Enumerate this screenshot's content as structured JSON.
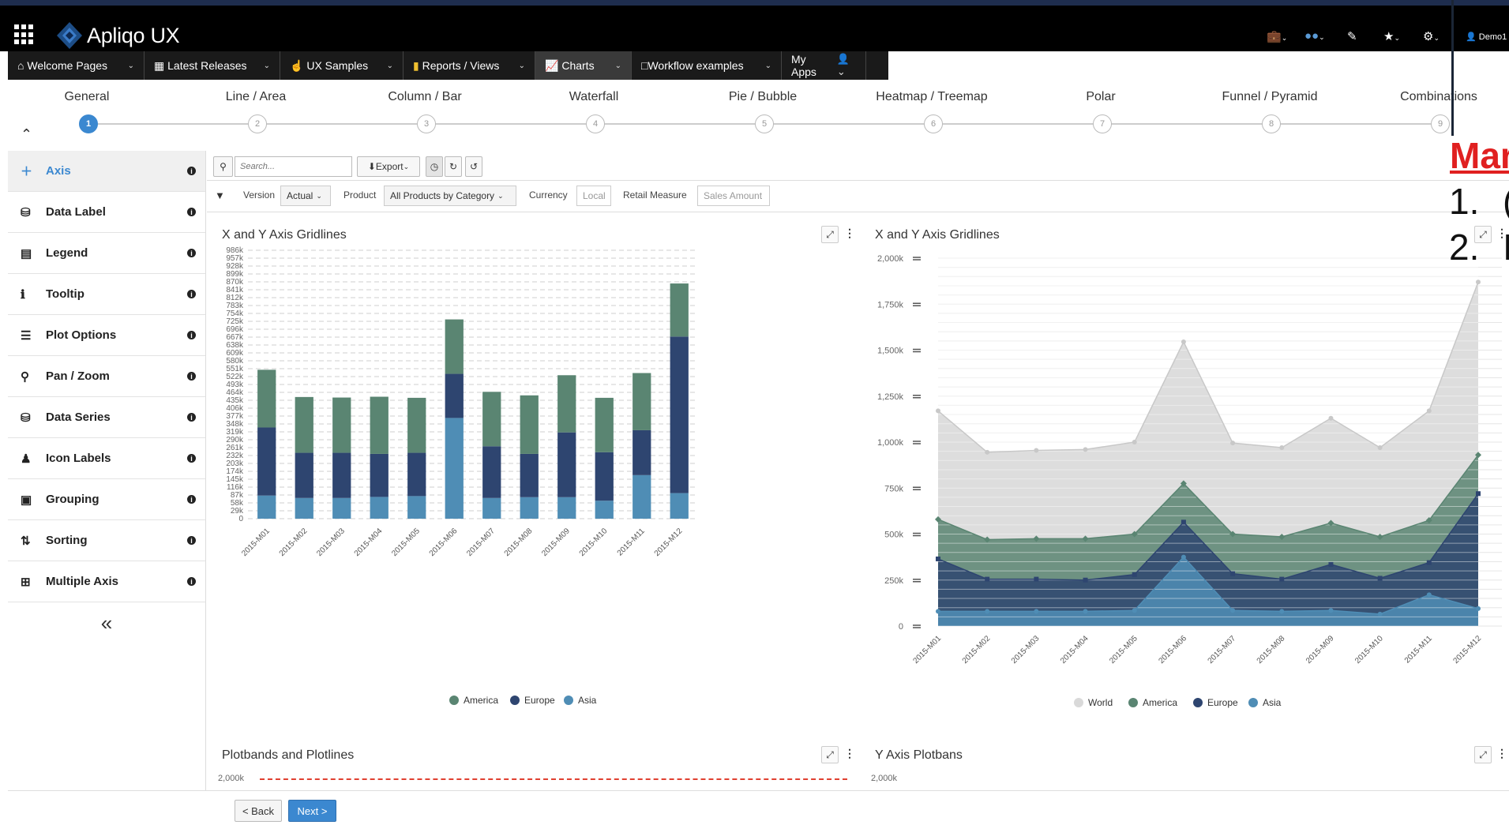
{
  "app": {
    "brand": "Apliqo UX",
    "user": "Demo1"
  },
  "nav": [
    {
      "label": "Welcome Pages",
      "icon": "home-icon"
    },
    {
      "label": "Latest Releases",
      "icon": "grid-icon"
    },
    {
      "label": "UX Samples",
      "icon": "hand-icon"
    },
    {
      "label": "Reports / Views",
      "icon": "bookmark-icon"
    },
    {
      "label": "Charts",
      "icon": "chart-icon"
    },
    {
      "label": "Workflow examples",
      "icon": "workflow-icon"
    },
    {
      "label": "My Apps",
      "icon": "user-icon"
    }
  ],
  "steps": [
    {
      "label": "General",
      "num": "1"
    },
    {
      "label": "Line / Area",
      "num": "2"
    },
    {
      "label": "Column / Bar",
      "num": "3"
    },
    {
      "label": "Waterfall",
      "num": "4"
    },
    {
      "label": "Pie / Bubble",
      "num": "5"
    },
    {
      "label": "Heatmap / Treemap",
      "num": "6"
    },
    {
      "label": "Polar",
      "num": "7"
    },
    {
      "label": "Funnel / Pyramid",
      "num": "8"
    },
    {
      "label": "Combinations",
      "num": "9"
    }
  ],
  "sidebar": [
    {
      "label": "Axis",
      "icon": "plus-icon"
    },
    {
      "label": "Data Label",
      "icon": "database-icon"
    },
    {
      "label": "Legend",
      "icon": "legend-icon"
    },
    {
      "label": "Tooltip",
      "icon": "info-icon"
    },
    {
      "label": "Plot Options",
      "icon": "list-icon"
    },
    {
      "label": "Pan / Zoom",
      "icon": "search-icon"
    },
    {
      "label": "Data Series",
      "icon": "database-icon"
    },
    {
      "label": "Icon Labels",
      "icon": "users-icon"
    },
    {
      "label": "Grouping",
      "icon": "grouping-icon"
    },
    {
      "label": "Sorting",
      "icon": "sort-icon"
    },
    {
      "label": "Multiple Axis",
      "icon": "plus-square-icon"
    }
  ],
  "toolbar": {
    "search_placeholder": "Search...",
    "export": "Export"
  },
  "filters": {
    "version_label": "Version",
    "version_value": "Actual",
    "product_label": "Product",
    "product_value": "All Products by Category",
    "currency_label": "Currency",
    "currency_value": "Local",
    "measure_label": "Retail Measure",
    "measure_value": "Sales Amount"
  },
  "bottom_titles": {
    "left": "Plotbands and Plotlines",
    "right": "Y Axis Plotbans",
    "left_tick": "2,000k",
    "right_tick": "2,000k"
  },
  "footer": {
    "back": "< Back",
    "next": "Next >"
  },
  "callout": {
    "title": "Mar",
    "items": [
      "1.",
      "2."
    ],
    "chars": [
      "(",
      "I"
    ]
  },
  "colors": {
    "america": "#5a8572",
    "europe": "#2e4570",
    "asia": "#4f8db5",
    "world": "#d9d9d9"
  },
  "chart_data": [
    {
      "type": "bar",
      "title": "X and Y Axis Gridlines",
      "categories": [
        "2015-M01",
        "2015-M02",
        "2015-M03",
        "2015-M04",
        "2015-M05",
        "2015-M06",
        "2015-M07",
        "2015-M08",
        "2015-M09",
        "2015-M10",
        "2015-M11",
        "2015-M12"
      ],
      "series": [
        {
          "name": "America",
          "values": [
            212,
            205,
            203,
            210,
            202,
            200,
            200,
            215,
            210,
            200,
            210,
            195
          ]
        },
        {
          "name": "Europe",
          "values": [
            250,
            166,
            166,
            158,
            159,
            162,
            190,
            159,
            238,
            178,
            165,
            575
          ]
        },
        {
          "name": "Asia",
          "values": [
            85,
            76,
            76,
            80,
            83,
            370,
            76,
            79,
            79,
            66,
            160,
            94
          ]
        }
      ],
      "stacked": true,
      "ylim": [
        0,
        986
      ],
      "yticks": [
        "0",
        "29k",
        "58k",
        "87k",
        "116k",
        "145k",
        "174k",
        "203k",
        "232k",
        "261k",
        "290k",
        "319k",
        "348k",
        "377k",
        "406k",
        "435k",
        "464k",
        "493k",
        "522k",
        "551k",
        "580k",
        "609k",
        "638k",
        "667k",
        "696k",
        "725k",
        "754k",
        "783k",
        "812k",
        "841k",
        "870k",
        "899k",
        "928k",
        "957k",
        "986k"
      ],
      "grid": true,
      "legend": "bottom"
    },
    {
      "type": "area",
      "title": "X and Y Axis Gridlines",
      "categories": [
        "2015-M01",
        "2015-M02",
        "2015-M03",
        "2015-M04",
        "2015-M05",
        "2015-M06",
        "2015-M07",
        "2015-M08",
        "2015-M09",
        "2015-M10",
        "2015-M11",
        "2015-M12"
      ],
      "series": [
        {
          "name": "World",
          "values": [
            1170,
            945,
            955,
            960,
            1000,
            1545,
            995,
            970,
            1130,
            970,
            1170,
            1870
          ]
        },
        {
          "name": "America",
          "values": [
            580,
            470,
            475,
            475,
            500,
            775,
            500,
            485,
            560,
            485,
            575,
            930
          ]
        },
        {
          "name": "Europe",
          "values": [
            365,
            255,
            255,
            250,
            280,
            565,
            285,
            255,
            335,
            260,
            345,
            720
          ]
        },
        {
          "name": "Asia",
          "values": [
            80,
            80,
            80,
            80,
            85,
            375,
            85,
            80,
            85,
            65,
            170,
            95
          ]
        }
      ],
      "ylim": [
        0,
        2000
      ],
      "yticks": [
        "0",
        "250k",
        "500k",
        "750k",
        "1,000k",
        "1,250k",
        "1,500k",
        "1,750k",
        "2,000k"
      ],
      "grid": true,
      "legend": "bottom"
    }
  ]
}
